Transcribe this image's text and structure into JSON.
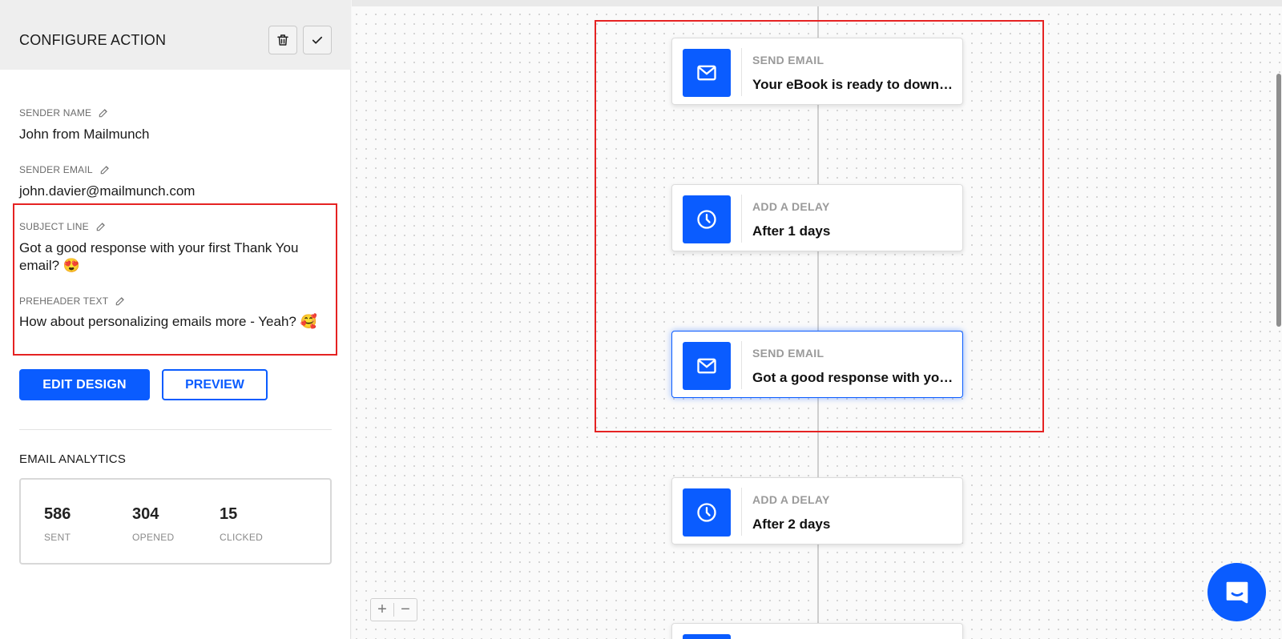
{
  "panel": {
    "title": "CONFIGURE ACTION",
    "fields": [
      {
        "label": "SENDER NAME",
        "value": "John from Mailmunch"
      },
      {
        "label": "SENDER EMAIL",
        "value": "john.davier@mailmunch.com"
      },
      {
        "label": "SUBJECT LINE",
        "value": "Got a good response with your first Thank You email? 😍"
      },
      {
        "label": "PREHEADER TEXT",
        "value": "How about personalizing emails more - Yeah? 🥰"
      }
    ],
    "edit_design_label": "EDIT DESIGN",
    "preview_label": "PREVIEW",
    "analytics": {
      "title": "EMAIL ANALYTICS",
      "stats": [
        {
          "value": "586",
          "label": "SENT"
        },
        {
          "value": "304",
          "label": "OPENED"
        },
        {
          "value": "15",
          "label": "CLICKED"
        }
      ]
    }
  },
  "workflow": {
    "nodes": [
      {
        "type": "SEND EMAIL",
        "text": "Your eBook is ready to download",
        "icon": "envelope-icon"
      },
      {
        "type": "ADD A DELAY",
        "text": "After 1 days",
        "icon": "clock-icon"
      },
      {
        "type": "SEND EMAIL",
        "text": "Got a good response with your first Thank You email?",
        "icon": "envelope-icon",
        "active": true
      },
      {
        "type": "ADD A DELAY",
        "text": "After 2 days",
        "icon": "clock-icon"
      }
    ]
  },
  "zoom": {
    "in_label": "+",
    "out_label": "−"
  },
  "colors": {
    "accent": "#0a5cff",
    "highlight": "#e52222"
  }
}
